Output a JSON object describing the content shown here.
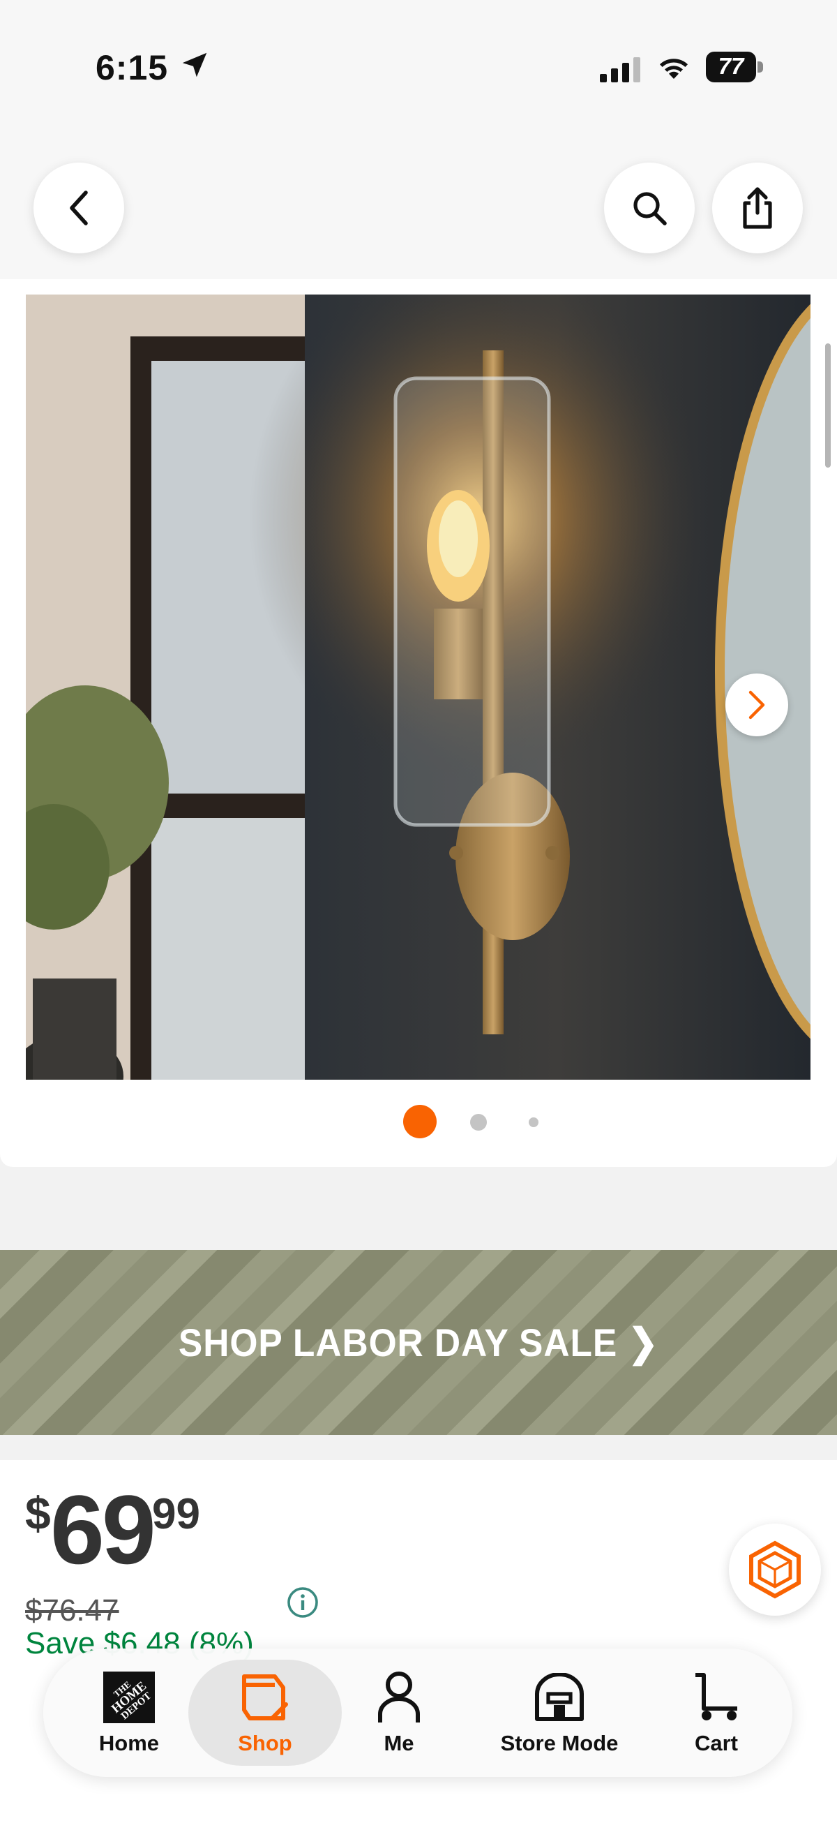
{
  "status_bar": {
    "time": "6:15",
    "battery": "77",
    "icons": [
      "location-arrow-icon",
      "signal-icon",
      "wifi-icon",
      "battery-icon"
    ]
  },
  "header": {
    "back_icon": "chevron-left-icon",
    "search_icon": "search-icon",
    "share_icon": "share-icon"
  },
  "gallery": {
    "image_alt": "Brass wall sconce with clear glass cylinder shade",
    "current_index": 1,
    "total": 3,
    "next_icon": "chevron-right-icon"
  },
  "promo": {
    "label": "SHOP LABOR DAY SALE ❯"
  },
  "price": {
    "currency": "$",
    "dollars": "69",
    "cents": "99",
    "was_price": "$76.47",
    "savings": "Save $6.48 (8%)"
  },
  "nav": {
    "items": [
      {
        "label": "Home",
        "icon": "home-depot-logo-icon"
      },
      {
        "label": "Shop",
        "icon": "shop-bag-icon"
      },
      {
        "label": "Me",
        "icon": "person-icon"
      },
      {
        "label": "Store Mode",
        "icon": "store-icon"
      },
      {
        "label": "Cart",
        "icon": "cart-icon"
      }
    ],
    "active": "Shop"
  },
  "colors": {
    "brand_orange": "#f96302",
    "savings_green": "#00853e",
    "info_teal": "#3a8a80"
  }
}
